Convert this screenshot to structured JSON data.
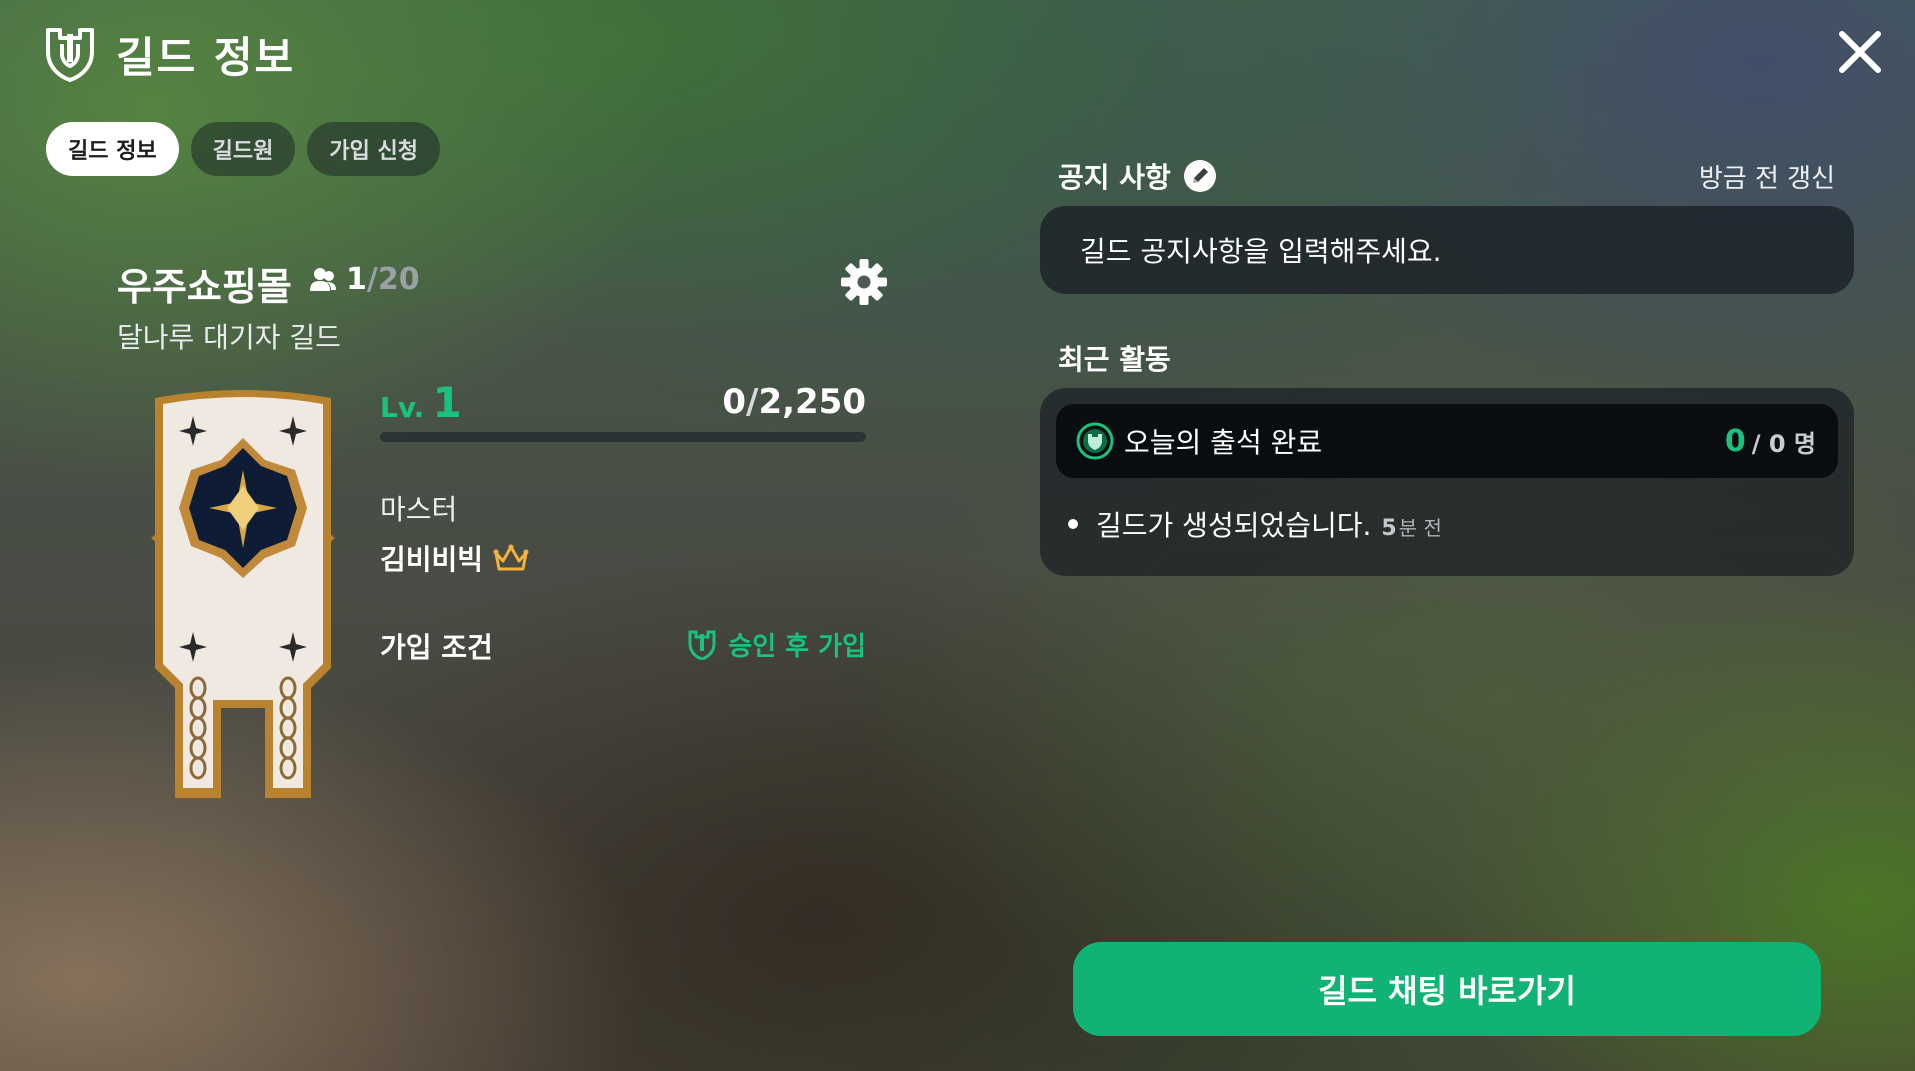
{
  "header": {
    "title": "길드 정보",
    "icon": "guild-shield-icon"
  },
  "close": {
    "icon": "close-icon"
  },
  "tabs": [
    {
      "label": "길드 정보",
      "active": true
    },
    {
      "label": "길드원",
      "active": false
    },
    {
      "label": "가입 신청",
      "active": false
    }
  ],
  "guild": {
    "name": "우주쇼핑몰",
    "members_current": "1",
    "members_separator": "/",
    "members_max": "20",
    "description": "달나루 대기자 길드",
    "level_prefix": "Lv.",
    "level": "1",
    "xp_current": "0",
    "xp_separator": "/",
    "xp_max": "2,250",
    "xp_progress": 0,
    "master_label": "마스터",
    "master_name": "김비비빅",
    "join_label": "가입 조건",
    "join_value": "승인 후 가입"
  },
  "notice": {
    "title": "공지 사항",
    "updated": "방금 전 갱신",
    "placeholder": "길드 공지사항을 입력해주세요."
  },
  "recent": {
    "title": "최근 활동",
    "attendance_label": "오늘의 출석 완료",
    "attendance_count": "0",
    "attendance_rest": "/ 0 명",
    "activities": [
      {
        "text": "길드가 생성되었습니다.",
        "time_num": "5",
        "time_unit": "분 전"
      }
    ]
  },
  "chat_button": {
    "label": "길드 채팅 바로가기"
  },
  "colors": {
    "accent": "#19c37d",
    "button": "#11b374",
    "crown": "#f2b33d"
  }
}
